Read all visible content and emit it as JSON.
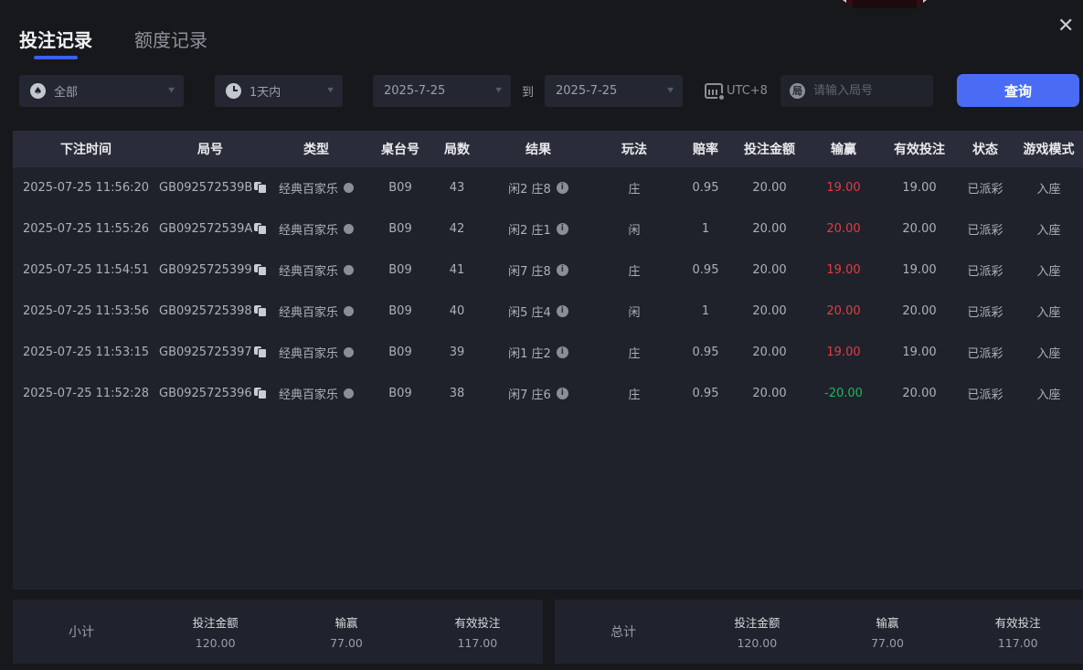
{
  "icons": {
    "close": "✕",
    "chevron": "▼",
    "spade": "♠",
    "info": "i",
    "round_char": "局"
  },
  "colors": {
    "accent_blue": "#4a6cf5",
    "tab_underline": "#3a5ff0",
    "win_red": "#e23c44",
    "loss_green": "#17b861"
  },
  "tabs": [
    {
      "label": "投注记录",
      "active": true
    },
    {
      "label": "额度记录",
      "active": false
    }
  ],
  "filters": {
    "game_type_value": "全部",
    "time_range_value": "1天内",
    "date_from": "2025-7-25",
    "to_label": "到",
    "date_to": "2025-7-25",
    "timezone": "UTC+8",
    "round_placeholder": "请输入局号",
    "query_button": "查询"
  },
  "table": {
    "headers": [
      "下注时间",
      "局号",
      "类型",
      "桌台号",
      "局数",
      "结果",
      "玩法",
      "赔率",
      "投注金额",
      "输赢",
      "有效投注",
      "状态",
      "游戏模式"
    ],
    "rows": [
      {
        "time": "2025-07-25 11:56:20",
        "round_id": "GB092572539B",
        "type": "经典百家乐",
        "table_no": "B09",
        "rounds": "43",
        "result": "闲2 庄8",
        "play": "庄",
        "odds": "0.95",
        "bet": "20.00",
        "win": "19.00",
        "win_color": "red",
        "valid": "19.00",
        "status": "已派彩",
        "mode": "入座"
      },
      {
        "time": "2025-07-25 11:55:26",
        "round_id": "GB092572539A",
        "type": "经典百家乐",
        "table_no": "B09",
        "rounds": "42",
        "result": "闲2 庄1",
        "play": "闲",
        "odds": "1",
        "bet": "20.00",
        "win": "20.00",
        "win_color": "red",
        "valid": "20.00",
        "status": "已派彩",
        "mode": "入座"
      },
      {
        "time": "2025-07-25 11:54:51",
        "round_id": "GB0925725399",
        "type": "经典百家乐",
        "table_no": "B09",
        "rounds": "41",
        "result": "闲7 庄8",
        "play": "庄",
        "odds": "0.95",
        "bet": "20.00",
        "win": "19.00",
        "win_color": "red",
        "valid": "19.00",
        "status": "已派彩",
        "mode": "入座"
      },
      {
        "time": "2025-07-25 11:53:56",
        "round_id": "GB0925725398",
        "type": "经典百家乐",
        "table_no": "B09",
        "rounds": "40",
        "result": "闲5 庄4",
        "play": "闲",
        "odds": "1",
        "bet": "20.00",
        "win": "20.00",
        "win_color": "red",
        "valid": "20.00",
        "status": "已派彩",
        "mode": "入座"
      },
      {
        "time": "2025-07-25 11:53:15",
        "round_id": "GB0925725397",
        "type": "经典百家乐",
        "table_no": "B09",
        "rounds": "39",
        "result": "闲1 庄2",
        "play": "庄",
        "odds": "0.95",
        "bet": "20.00",
        "win": "19.00",
        "win_color": "red",
        "valid": "19.00",
        "status": "已派彩",
        "mode": "入座"
      },
      {
        "time": "2025-07-25 11:52:28",
        "round_id": "GB0925725396",
        "type": "经典百家乐",
        "table_no": "B09",
        "rounds": "38",
        "result": "闲7 庄6",
        "play": "庄",
        "odds": "0.95",
        "bet": "20.00",
        "win": "-20.00",
        "win_color": "green",
        "valid": "20.00",
        "status": "已派彩",
        "mode": "入座"
      }
    ]
  },
  "summary": {
    "subtotal": {
      "label": "小计",
      "items": [
        {
          "label": "投注金额",
          "value": "120.00",
          "color": ""
        },
        {
          "label": "输赢",
          "value": "77.00",
          "color": "red"
        },
        {
          "label": "有效投注",
          "value": "117.00",
          "color": ""
        }
      ]
    },
    "total": {
      "label": "总计",
      "items": [
        {
          "label": "投注金额",
          "value": "120.00",
          "color": ""
        },
        {
          "label": "输赢",
          "value": "77.00",
          "color": "red"
        },
        {
          "label": "有效投注",
          "value": "117.00",
          "color": ""
        }
      ]
    }
  }
}
